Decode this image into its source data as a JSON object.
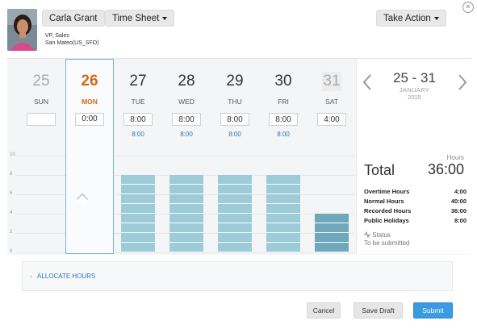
{
  "user": {
    "name": "Carla Grant",
    "role": "VP, Sales",
    "location": "San Mateo(US_SFO)"
  },
  "header": {
    "timesheet_label": "Time Sheet",
    "take_action_label": "Take Action"
  },
  "week": {
    "range": "25 - 31",
    "month": "JANUARY",
    "year": "2015"
  },
  "days": [
    {
      "num": "25",
      "name": "SUN",
      "value": "",
      "scheduled": ""
    },
    {
      "num": "26",
      "name": "MON",
      "value": "0",
      "value_min": "00",
      "scheduled": ""
    },
    {
      "num": "27",
      "name": "TUE",
      "value": "8:00",
      "scheduled": "8:00"
    },
    {
      "num": "28",
      "name": "WED",
      "value": "8:00",
      "scheduled": "8:00"
    },
    {
      "num": "29",
      "name": "THU",
      "value": "8:00",
      "scheduled": "8:00"
    },
    {
      "num": "30",
      "name": "FRI",
      "value": "8:00",
      "scheduled": "8:00"
    },
    {
      "num": "31",
      "name": "SAT",
      "value": "4:00",
      "scheduled": ""
    }
  ],
  "chart_data": {
    "type": "bar",
    "categories": [
      "SUN",
      "MON",
      "TUE",
      "WED",
      "THU",
      "FRI",
      "SAT"
    ],
    "values": [
      0,
      0,
      8,
      8,
      8,
      8,
      4
    ],
    "ylim": [
      0,
      10
    ],
    "yticks": [
      "10",
      "8",
      "6",
      "4",
      "2",
      "0"
    ],
    "colors": {
      "weekday": "#9dccd8",
      "weekend": "#6fa8ba"
    }
  },
  "summary": {
    "hours_label": "Hours",
    "total_label": "Total",
    "total_value": "36:00",
    "rows": [
      {
        "label": "Overtime Hours",
        "value": "4:00"
      },
      {
        "label": "Normal Hours",
        "value": "40:00"
      },
      {
        "label": "Recorded Hours",
        "value": "36:00"
      },
      {
        "label": "Public Holidays",
        "value": "8:00"
      }
    ],
    "status_label": "Status",
    "status_value": "To be submitted"
  },
  "allocate": {
    "label": "ALLOCATE HOURS"
  },
  "footer": {
    "cancel": "Cancel",
    "save_draft": "Save Draft",
    "submit": "Submit"
  }
}
